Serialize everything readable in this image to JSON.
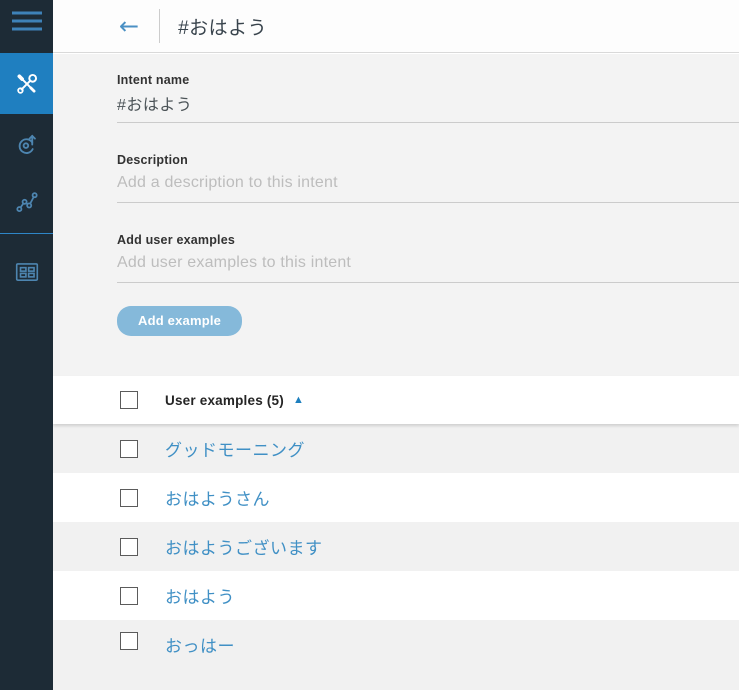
{
  "sidebar": {
    "items": [
      {
        "name": "menu",
        "icon": "hamburger-icon",
        "active": false
      },
      {
        "name": "build",
        "icon": "tools-icon",
        "active": true
      },
      {
        "name": "improve",
        "icon": "improve-icon",
        "active": false
      },
      {
        "name": "analytics",
        "icon": "analytics-icon",
        "active": false
      },
      {
        "name": "content-catalog",
        "icon": "catalog-icon",
        "active": false
      }
    ]
  },
  "header": {
    "back_icon": "←",
    "title": "#おはよう"
  },
  "form": {
    "intent_name": {
      "label": "Intent name",
      "value": "#おはよう"
    },
    "description": {
      "label": "Description",
      "placeholder": "Add a description to this intent",
      "value": ""
    },
    "user_examples": {
      "label": "Add user examples",
      "placeholder": "Add user examples to this intent",
      "value": ""
    },
    "add_example_button": "Add example"
  },
  "examples_table": {
    "header_label": "User examples (5)",
    "sort_indicator": "▲",
    "rows": [
      "グッドモーニング",
      "おはようさん",
      "おはようございます",
      "おはよう",
      "おっはー"
    ]
  },
  "colors": {
    "sidebar_bg": "#1d2b36",
    "active_nav_bg": "#1f7fc0",
    "nav_icon_blue": "#4d85b0",
    "link_text_blue": "#4090c5",
    "button_blue": "#85b9da",
    "form_bg": "#f3f3f3",
    "row_alt_bg": "#f1f1f1",
    "sort_triangle_blue": "#1d7fbe"
  }
}
